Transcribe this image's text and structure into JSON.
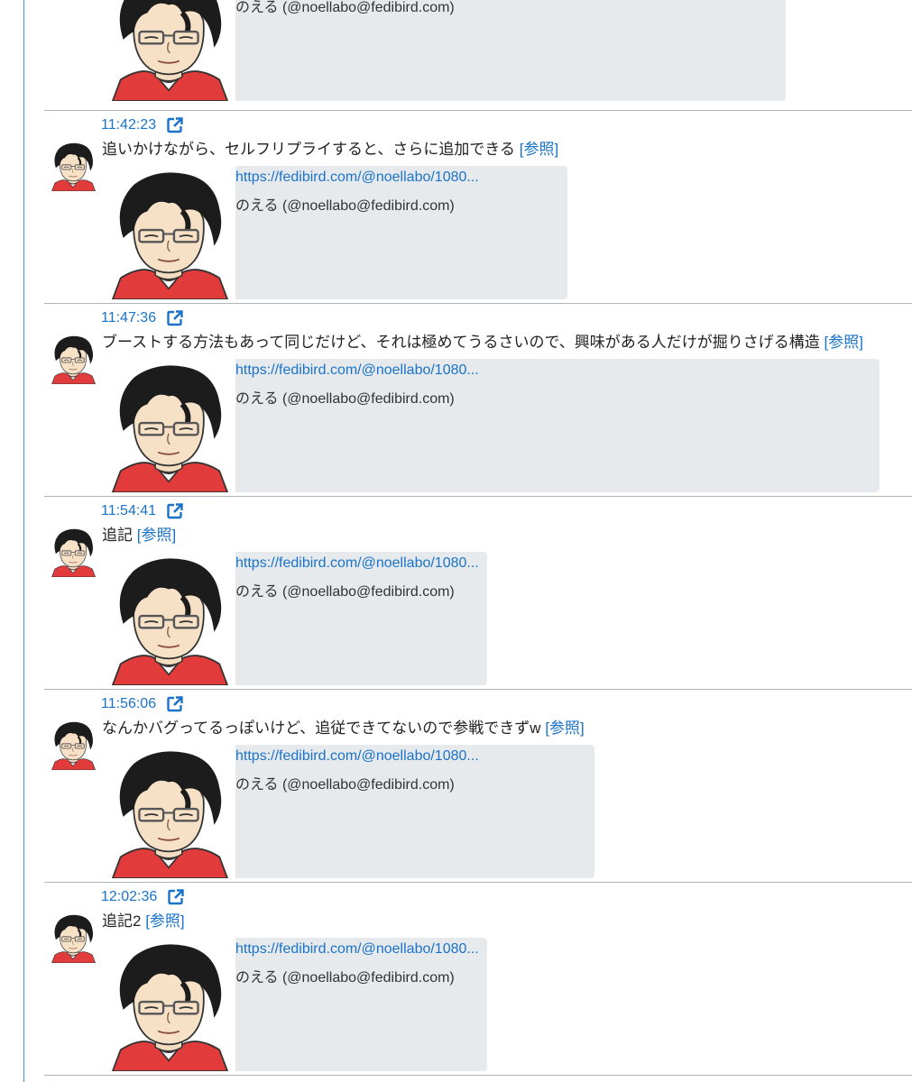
{
  "partial_post": {
    "card_author": "のえる (@noellabo@fedibird.com)"
  },
  "posts": [
    {
      "time": "11:42:23",
      "text": "追いかけながら、セルフリプライすると、さらに追加できる",
      "ref": "[参照]",
      "card_url": "https://fedibird.com/@noellabo/1080...",
      "card_author": "のえる (@noellabo@fedibird.com)"
    },
    {
      "time": "11:47:36",
      "text": "ブーストする方法もあって同じだけど、それは極めてうるさいので、興味がある人だけが掘りさげる構造",
      "ref": "[参照]",
      "card_url": "https://fedibird.com/@noellabo/1080...",
      "card_author": "のえる (@noellabo@fedibird.com)"
    },
    {
      "time": "11:54:41",
      "text": "追記",
      "ref": "[参照]",
      "card_url": "https://fedibird.com/@noellabo/1080...",
      "card_author": "のえる (@noellabo@fedibird.com)"
    },
    {
      "time": "11:56:06",
      "text": "なんかバグってるっぽいけど、追従できてないので参戦できずw",
      "ref": "[参照]",
      "card_url": "https://fedibird.com/@noellabo/1080...",
      "card_author": "のえる (@noellabo@fedibird.com)"
    },
    {
      "time": "12:02:36",
      "text": "追記2",
      "ref": "[参照]",
      "card_url": "https://fedibird.com/@noellabo/1080...",
      "card_author": "のえる (@noellabo@fedibird.com)"
    }
  ],
  "colors": {
    "link": "#1a73c8",
    "card_bg": "#e7eaed",
    "divider": "#aeb4b9",
    "left_border": "#4a90d9"
  }
}
